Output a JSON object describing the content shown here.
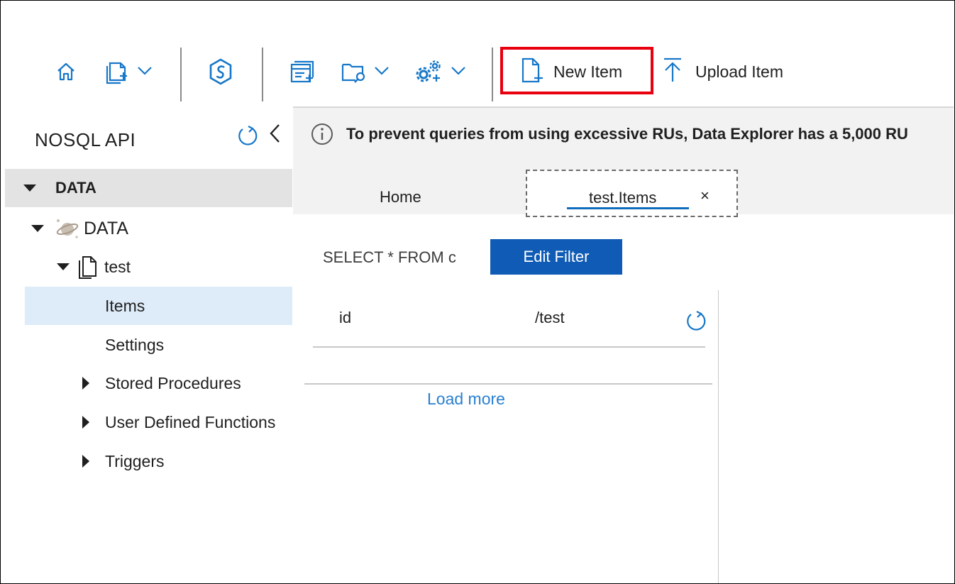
{
  "toolbar": {
    "items": [
      {
        "name": "home",
        "icon": "home-icon"
      },
      {
        "name": "new-container",
        "icon": "new-container-icon",
        "dropdown": true
      },
      {
        "name": "open-synapse",
        "icon": "synapse-icon"
      },
      {
        "name": "new-sql-query",
        "icon": "new-query-icon"
      },
      {
        "name": "open-query",
        "icon": "open-query-icon",
        "dropdown": true
      },
      {
        "name": "settings-options",
        "icon": "gears-icon",
        "dropdown": true
      }
    ],
    "new_item_label": "New Item",
    "upload_item_label": "Upload Item",
    "highlight_color": "#e8000f"
  },
  "sidebar": {
    "title": "NOSQL API",
    "section_header": "DATA",
    "database": "DATA",
    "container": "test",
    "items_label": "Items",
    "settings_label": "Settings",
    "stored_procedures_label": "Stored Procedures",
    "udf_label": "User Defined Functions",
    "triggers_label": "Triggers",
    "selected_color": "#deecf9"
  },
  "banner": {
    "text": "To prevent queries from using excessive RUs, Data Explorer has a 5,000 RU"
  },
  "tabs": {
    "home_label": "Home",
    "active_label": "test.Items",
    "close_symbol": "×"
  },
  "query": {
    "text": "SELECT * FROM c",
    "edit_filter_label": "Edit Filter"
  },
  "results": {
    "columns": [
      "id",
      "/test"
    ],
    "load_more_label": "Load more"
  },
  "colors": {
    "accent": "#0f6cbd",
    "button": "#0f5bb5",
    "link": "#2a7fd0"
  }
}
